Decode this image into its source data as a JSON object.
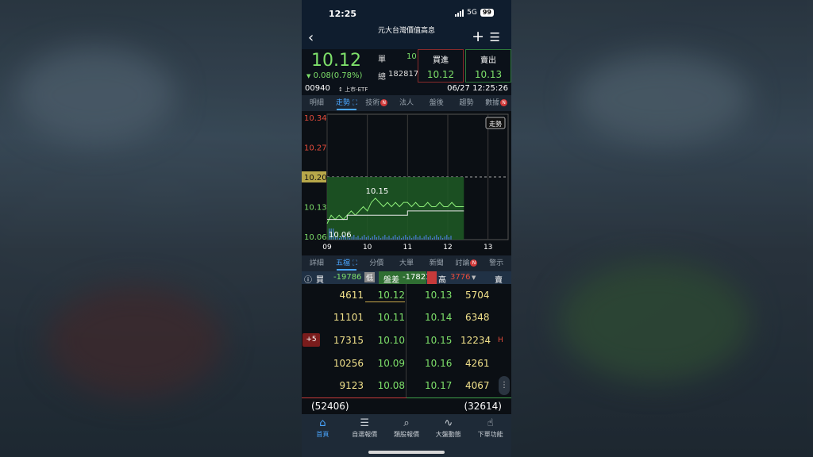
{
  "status": {
    "time": "12:25",
    "network": "5G",
    "battery": "99"
  },
  "nav": {
    "title": "元大台灣價值高息"
  },
  "quote": {
    "price": "10.12",
    "change": "0.08(0.78%)",
    "arrow": "▼",
    "single_label": "單",
    "single_value": "10",
    "total_label": "總",
    "total_value": "182817",
    "bid_label": "買進",
    "bid_value": "10.12",
    "ask_label": "賣出",
    "ask_value": "10.13",
    "code": "00940",
    "market": "上市-ETF",
    "datetime": "06/27 12:25:26"
  },
  "tabs": [
    {
      "label": "明細"
    },
    {
      "label": "走勢"
    },
    {
      "label": "技術"
    },
    {
      "label": "法人"
    },
    {
      "label": "盤後"
    },
    {
      "label": "趨勢"
    },
    {
      "label": "數據"
    }
  ],
  "badge": "N",
  "chart_data": {
    "type": "line",
    "y_ticks": [
      "10.34",
      "10.27",
      "10.20",
      "10.13",
      "10.06"
    ],
    "x_ticks": [
      "09",
      "10",
      "11",
      "12",
      "13"
    ],
    "reference": "10.20",
    "high_label": "10.15",
    "low_label": "10.06",
    "mode_button": "走勢",
    "ylim": [
      10.06,
      10.34
    ],
    "price_x": [
      9.0,
      9.05,
      9.1,
      9.2,
      9.3,
      9.4,
      9.5,
      9.6,
      9.7,
      9.8,
      9.9,
      10.0,
      10.1,
      10.2,
      10.3,
      10.4,
      10.5,
      10.6,
      10.7,
      10.8,
      10.9,
      11.0,
      11.1,
      11.2,
      11.3,
      11.4,
      11.5,
      11.6,
      11.7,
      11.8,
      11.9,
      12.0,
      12.1,
      12.2,
      12.3,
      12.4
    ],
    "price_y": [
      10.09,
      10.1,
      10.11,
      10.1,
      10.11,
      10.1,
      10.11,
      10.12,
      10.11,
      10.12,
      10.13,
      10.12,
      10.14,
      10.15,
      10.14,
      10.13,
      10.14,
      10.13,
      10.14,
      10.13,
      10.14,
      10.14,
      10.13,
      10.14,
      10.13,
      10.13,
      10.14,
      10.13,
      10.13,
      10.14,
      10.13,
      10.13,
      10.14,
      10.13,
      10.13,
      10.13
    ],
    "avg_x": [
      9.0,
      9.1,
      9.5,
      10.0,
      10.5,
      11.0,
      11.5,
      12.0,
      12.4
    ],
    "avg_y": [
      10.1,
      10.1,
      10.11,
      10.11,
      10.11,
      10.12,
      10.12,
      10.12,
      10.12
    ]
  },
  "tabs2": [
    {
      "label": "詳細"
    },
    {
      "label": "五檔"
    },
    {
      "label": "分價"
    },
    {
      "label": "大單"
    },
    {
      "label": "新聞"
    },
    {
      "label": "討論"
    },
    {
      "label": "警示"
    }
  ],
  "summary": {
    "buy_label": "買",
    "buy_value": "-19786",
    "low_label": "低",
    "diff_label": "盤差",
    "diff_value": "-17821",
    "high_label": "高",
    "high_value": "3776",
    "sell_label": "賣"
  },
  "book": [
    {
      "bid_vol": "4611",
      "bid": "10.12",
      "ask": "10.13",
      "ask_vol": "5704",
      "tag": "",
      "flag": ""
    },
    {
      "bid_vol": "11101",
      "bid": "10.11",
      "ask": "10.14",
      "ask_vol": "6348",
      "tag": "",
      "flag": ""
    },
    {
      "bid_vol": "17315",
      "bid": "10.10",
      "ask": "10.15",
      "ask_vol": "12234",
      "tag": "+5",
      "flag": "H"
    },
    {
      "bid_vol": "10256",
      "bid": "10.09",
      "ask": "10.16",
      "ask_vol": "4261",
      "tag": "",
      "flag": ""
    },
    {
      "bid_vol": "9123",
      "bid": "10.08",
      "ask": "10.17",
      "ask_vol": "4067",
      "tag": "",
      "flag": ""
    }
  ],
  "totals": {
    "bid_total": "(52406)",
    "ask_total": "(32614)"
  },
  "bottom_nav": [
    {
      "label": "首頁",
      "icon": "home-icon"
    },
    {
      "label": "自選報價",
      "icon": "list-icon"
    },
    {
      "label": "類股報價",
      "icon": "chart-search-icon"
    },
    {
      "label": "大盤動態",
      "icon": "pulse-icon"
    },
    {
      "label": "下單功能",
      "icon": "hand-icon"
    }
  ],
  "colors": {
    "up": "#e74c3c",
    "down": "#7ee06a",
    "accent": "#4aa6ff",
    "price": "#f0e08a"
  }
}
